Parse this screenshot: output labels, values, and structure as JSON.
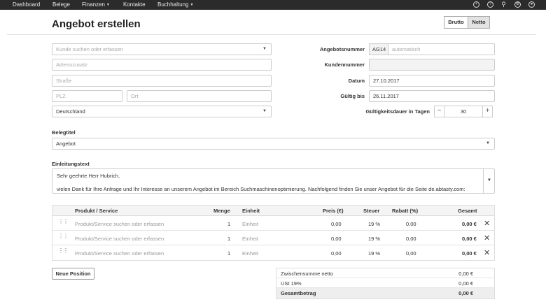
{
  "nav": {
    "items": [
      {
        "label": "Dashboard",
        "has_menu": false
      },
      {
        "label": "Belege",
        "has_menu": false
      },
      {
        "label": "Finanzen",
        "has_menu": true
      },
      {
        "label": "Kontakte",
        "has_menu": false
      },
      {
        "label": "Buchhaltung",
        "has_menu": true
      }
    ],
    "icons": [
      "add-icon",
      "help-icon",
      "search-icon",
      "settings-icon",
      "user-icon"
    ]
  },
  "page": {
    "title": "Angebot erstellen",
    "toggle": {
      "brutto": "Brutto",
      "netto": "Netto",
      "selected": "Netto"
    }
  },
  "customer": {
    "search_placeholder": "Kunde suchen oder erfassen",
    "address_extra_placeholder": "Adresszusatz",
    "street_placeholder": "Straße",
    "zip_placeholder": "PLZ",
    "city_placeholder": "Ort",
    "country": "Deutschland"
  },
  "meta": {
    "number_label": "Angebotsnummer",
    "number_prefix": "AG14",
    "number_placeholder": "automatisch",
    "customer_number_label": "Kundennummer",
    "date_label": "Datum",
    "date_value": "27.10.2017",
    "valid_label": "Gültig bis",
    "valid_value": "26.11.2017",
    "duration_label": "Gültigkeitsdauer in Tagen",
    "duration_value": "30",
    "minus": "−",
    "plus": "+"
  },
  "doc_title": {
    "label": "Belegtitel",
    "value": "Angebot"
  },
  "intro": {
    "label": "Einleitungstext",
    "line1": "Sehr geehrte Herr Hubrich,",
    "line2": "vielen Dank für Ihre Anfrage und Ihr Interesse an unserem Angebot im Bereich Suchmaschinenoptimierung. Nachfolgend finden Sie unser Angebot für die Seite de.abtasty.com:"
  },
  "table": {
    "headers": {
      "product": "Produkt / Service",
      "qty": "Menge",
      "unit": "Einheit",
      "price": "Preis (€)",
      "tax": "Steuer",
      "discount": "Rabatt (%)",
      "total": "Gesamt"
    },
    "rows": [
      {
        "product": "Produkt/Service suchen oder erfassen",
        "qty": "1",
        "unit": "Einheit",
        "price": "0,00",
        "tax": "19 %",
        "discount": "0,00",
        "total": "0,00 €"
      },
      {
        "product": "Produkt/Service suchen oder erfassen",
        "qty": "1",
        "unit": "Einheit",
        "price": "0,00",
        "tax": "19 %",
        "discount": "0,00",
        "total": "0,00 €"
      },
      {
        "product": "Produkt/Service suchen oder erfassen",
        "qty": "1",
        "unit": "Einheit",
        "price": "0,00",
        "tax": "19 %",
        "discount": "0,00",
        "total": "0,00 €"
      }
    ]
  },
  "new_position_label": "Neue Position",
  "totals": {
    "subtotal_label": "Zwischensumme netto",
    "subtotal_value": "0,00 €",
    "tax_label": "USt 19%",
    "tax_value": "0,00 €",
    "total_label": "Gesamtbetrag",
    "total_value": "0,00 €"
  }
}
